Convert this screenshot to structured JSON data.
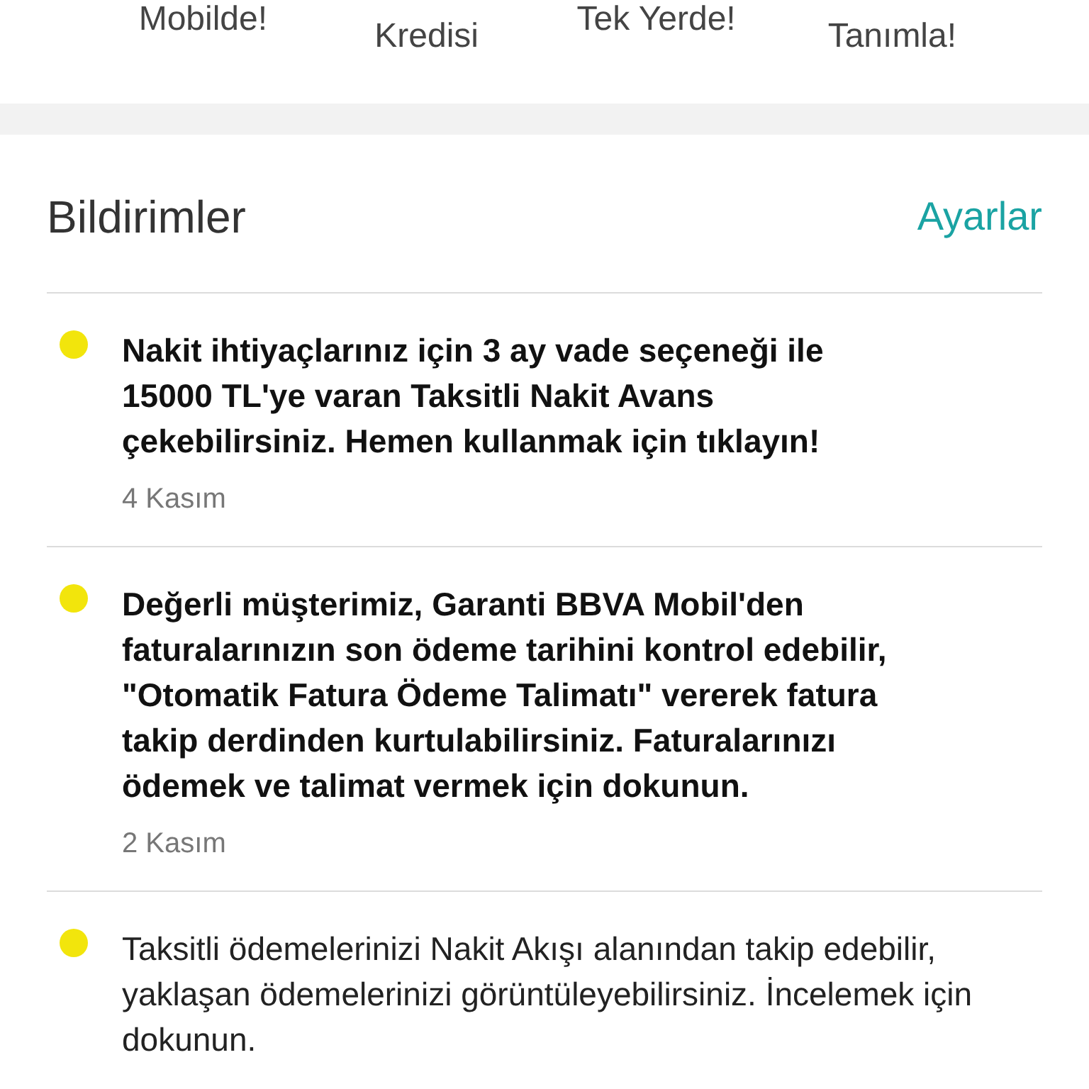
{
  "shortcuts": [
    {
      "label": "Mobilde!"
    },
    {
      "label": "Kredisi"
    },
    {
      "label": "Tek Yerde!"
    },
    {
      "label": "Tanımla!"
    }
  ],
  "notifications": {
    "title": "Bildirimler",
    "settings_link": "Ayarlar",
    "items": [
      {
        "text": "Nakit ihtiyaçlarınız için 3 ay vade seçeneği ile 15000 TL'ye varan Taksitli Nakit Avans çekebilirsiniz. Hemen kullanmak için tıklayın!",
        "date": "4 Kasım",
        "unread": true
      },
      {
        "text": "Değerli müşterimiz, Garanti BBVA Mobil'den faturalarınızın son ödeme tarihini kontrol edebilir, \"Otomatik Fatura Ödeme Talimatı\" vererek fatura takip derdinden kurtulabilirsiniz. Faturalarınızı ödemek ve talimat vermek için dokunun.",
        "date": "2 Kasım",
        "unread": true
      },
      {
        "text": "Taksitli ödemelerinizi Nakit Akışı alanından takip edebilir, yaklaşan ödemelerinizi görüntüleyebilirsiniz. İncelemek için dokunun.",
        "unread": false
      }
    ]
  }
}
